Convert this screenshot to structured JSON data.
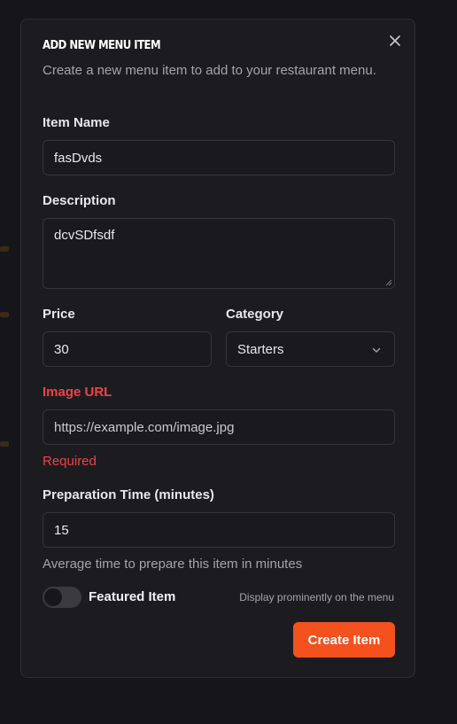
{
  "dialog": {
    "title": "Add New Menu Item",
    "subtitle": "Create a new menu item to add to your restaurant menu.",
    "close_icon": "close-icon"
  },
  "form": {
    "item_name": {
      "label": "Item Name",
      "value": "fasDvds"
    },
    "description": {
      "label": "Description",
      "value": "dcvSDfsdf"
    },
    "price": {
      "label": "Price",
      "value": "30"
    },
    "category": {
      "label": "Category",
      "value": "Starters"
    },
    "image_url": {
      "label": "Image URL",
      "placeholder": "https://example.com/image.jpg",
      "error": "Required"
    },
    "prep_time": {
      "label": "Preparation Time (minutes)",
      "value": "15",
      "helper": "Average time to prepare this item in minutes"
    },
    "featured": {
      "label": "Featured Item",
      "hint": "Display prominently on the menu",
      "checked": false
    },
    "submit_label": "Create Item"
  },
  "colors": {
    "accent": "#f4511e",
    "error": "#ef4444",
    "modal_bg": "#1c1c20"
  }
}
